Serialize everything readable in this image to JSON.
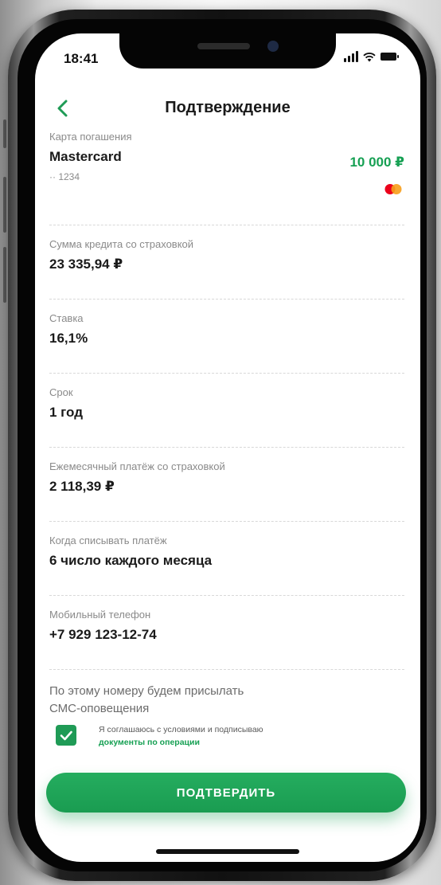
{
  "status_bar": {
    "time": "18:41"
  },
  "header": {
    "title": "Подтверждение"
  },
  "card": {
    "label": "Карта погашения",
    "name": "Mastercard",
    "number": "·· 1234",
    "amount": "10 000 ₽",
    "logo": "mastercard-icon"
  },
  "fields": [
    {
      "label": "Сумма кредита со страховкой",
      "value": "23 335,94 ₽"
    },
    {
      "label": "Ставка",
      "value": "16,1%"
    },
    {
      "label": "Срок",
      "value": "1 год"
    },
    {
      "label": "Ежемесячный платёж со страховкой",
      "value": "2 118,39 ₽"
    },
    {
      "label": "Когда списывать платёж",
      "value": "6 число каждого месяца"
    },
    {
      "label": "Мобильный телефон",
      "value": "+7 929 123-12-74"
    }
  ],
  "sms_note": {
    "line1": "По этому номеру будем присылать",
    "line2": "СМС-оповещения"
  },
  "agreement": {
    "checked": true,
    "text": "Я соглашаюсь с условиями и подписываю",
    "link": "документы по операции"
  },
  "confirm_button": {
    "label": "ПОДТВЕРДИТЬ"
  },
  "colors": {
    "accent": "#1F9B56",
    "accent_text": "#16A053"
  }
}
